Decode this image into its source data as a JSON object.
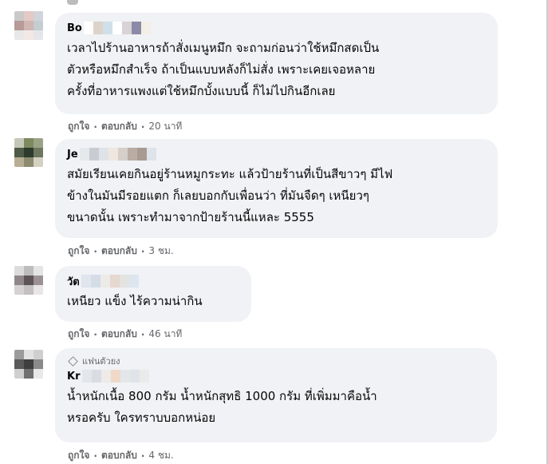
{
  "comments": [
    {
      "name_prefix": "Bo",
      "badge": "",
      "text": "เวลาไปร้านอาหารถ้าสั่งเมนูหมึก จะถามก่อนว่าใช้หมึกสดเป็น\nตัวหรือหมึกสำเร็จ ถ้าเป็นแบบหลังก็ไม่สั่ง เพราะเคยเจอหลาย\nครั้งที่อาหารแพงแต่ใช้หมึกบั้งแบบนี้ ก็ไม่ไปกินอีกเลย",
      "like_label": "ถูกใจ",
      "reply_label": "ตอบกลับ",
      "time": "20 นาที",
      "avatar_colors": [
        "#c9c9c9",
        "#e5c9c5",
        "#cfd5d9",
        "#b89a98",
        "#d0b7b3",
        "#c4cdd2",
        "#e8e8e8",
        "#f2e8e6",
        "#e4e6e8"
      ],
      "name_blur_colors": [
        "#ffffff",
        "#dcd4ca",
        "#cfe0ea",
        "#ffffff",
        "#d9d2d6",
        "#8c8aa8",
        "#f4efe6"
      ]
    },
    {
      "name_prefix": "Je",
      "badge": "",
      "text": "สมัยเรียนเคยกินอยู่ร้านหมูกระทะ แล้วป้ายร้านที่เป็นสีขาวๆ มีไฟ\nข้างในมันมีรอยแตก ก็เลยบอกกับเพื่อนว่า ที่มันจืดๆ เหนียวๆ\nขนาดนั้น เพราะทำมาจากป้ายร้านนี้แหละ 5555",
      "like_label": "ถูกใจ",
      "reply_label": "ตอบกลับ",
      "time": "3 ชม.",
      "avatar_colors": [
        "#c5c8b8",
        "#7d8a60",
        "#9aa387",
        "#4f5a48",
        "#2e3a2c",
        "#6d765f",
        "#b7ae93",
        "#8d8c71",
        "#d5d1c2"
      ],
      "name_blur_colors": [
        "#e6e9ec",
        "#c9cdd3",
        "#dfe3e7",
        "#efe7df",
        "#d5cfc9",
        "#b9aca3",
        "#a89a92",
        "#dfe4ea"
      ]
    },
    {
      "name_prefix": "วัต",
      "badge": "",
      "text": "เหนียว แข็ง ไร้ความน่ากิน",
      "like_label": "ถูกใจ",
      "reply_label": "ตอบกลับ",
      "time": "46 นาที",
      "avatar_colors": [
        "#dcdcdc",
        "#bcbcbc",
        "#e4e4e4",
        "#8f8789",
        "#5e5357",
        "#9a9095",
        "#d6d2d3",
        "#c4bfc1",
        "#e8e6e7"
      ],
      "name_blur_colors": [
        "#dfe6ee",
        "#d4dde6",
        "#ecebe8",
        "#e6d7cf",
        "#e3e3e1",
        "#dde6ee"
      ]
    },
    {
      "name_prefix": "Kr",
      "badge": "แฟนตัวยง",
      "text": "น้ำหนักเนื้อ 800 กรัม น้ำหนักสุทธิ 1000 กรัม ที่เพิ่มมาคือน้ำ\nหรอครับ ใครทราบบอกหน่อย",
      "like_label": "ถูกใจ",
      "reply_label": "ตอบกลับ",
      "time": "4 ชม.",
      "avatar_colors": [
        "#9b9b9b",
        "#e2e2e2",
        "#cfcfcf",
        "#5a5a5a",
        "#3e3e3e",
        "#8a8a8a",
        "#cfcfcf",
        "#707070",
        "#e8e8e8"
      ],
      "name_blur_colors": [
        "#e3e6ea",
        "#d9dde2",
        "#ecebe9",
        "#f0d9c8",
        "#e4e7ea",
        "#e0e4e8",
        "#eaeaea"
      ]
    }
  ]
}
